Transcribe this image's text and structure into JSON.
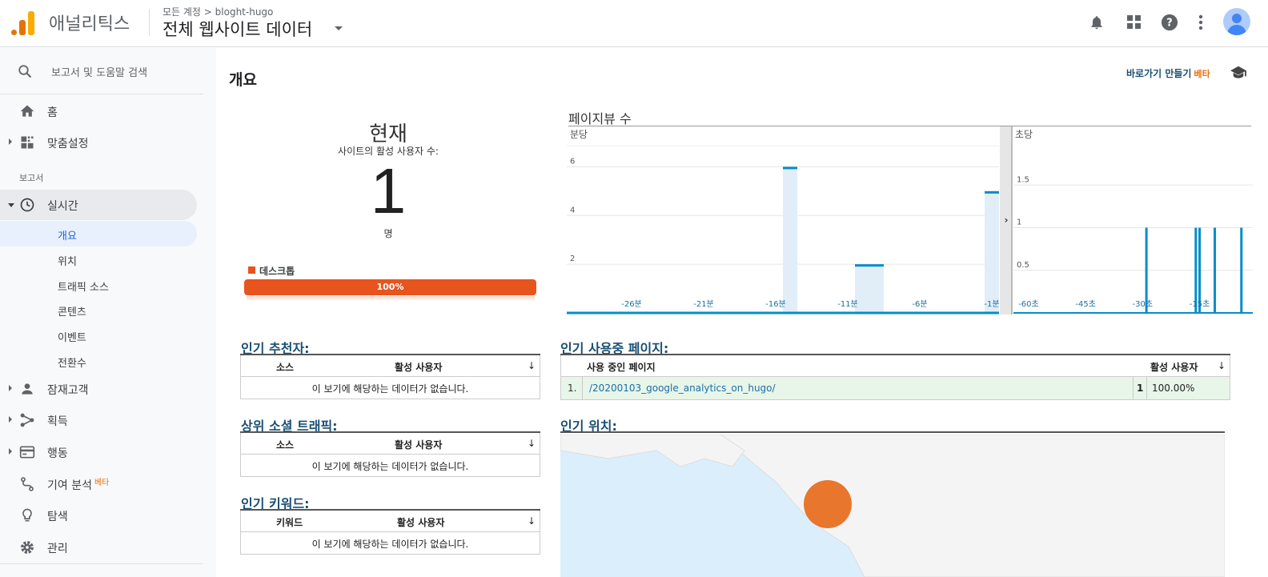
{
  "header": {
    "app_name": "애널리틱스",
    "breadcrumb": "모든 계정 > bloght-hugo",
    "view_name": "전체 웹사이트 데이터"
  },
  "sidebar": {
    "search_placeholder": "보고서 및 도움말 검색",
    "home": "홈",
    "customize": "맞춤설정",
    "reports_label": "보고서",
    "realtime": "실시간",
    "realtime_items": [
      "개요",
      "위치",
      "트래픽 소스",
      "콘텐츠",
      "이벤트",
      "전환수"
    ],
    "audience": "잠재고객",
    "acquisition": "획득",
    "behavior": "행동",
    "attribution": "기여 분석",
    "attribution_badge": "베타",
    "discover": "탐색",
    "admin": "관리"
  },
  "main": {
    "title": "개요",
    "shortcut_label": "바로가기 만들기",
    "shortcut_badge": "베타",
    "now": {
      "heading": "현재",
      "subtitle": "사이트의 활성 사용자 수:",
      "count": "1",
      "unit": "명",
      "device_label": "데스크톱",
      "device_percent": "100%",
      "device_fraction": 1.0
    },
    "top_referrals": {
      "title": "인기 추천자:",
      "col1": "소스",
      "col2": "활성 사용자",
      "empty": "이 보기에 해당하는 데이터가 없습니다."
    },
    "top_social": {
      "title": "상위 소셜 트래픽:",
      "col1": "소스",
      "col2": "활성 사용자",
      "empty": "이 보기에 해당하는 데이터가 없습니다."
    },
    "top_keywords": {
      "title": "인기 키워드:",
      "col1": "키워드",
      "col2": "활성 사용자",
      "empty": "이 보기에 해당하는 데이터가 없습니다."
    },
    "top_pages": {
      "title": "인기 사용중 페이지:",
      "col1": "사용 중인 페이지",
      "col2": "활성 사용자",
      "rows": [
        {
          "rank": "1.",
          "page": "/20200103_google_analytics_on_hugo/",
          "users": "1",
          "percent": "100.00%"
        }
      ]
    },
    "top_locations": {
      "title": "인기 위치:"
    }
  },
  "chart_data": [
    {
      "type": "bar",
      "title": "페이지뷰 수",
      "subtitle": "분당",
      "x_tick_labels": [
        "-26분",
        "-21분",
        "-16분",
        "-11분",
        "-6분",
        "-1분"
      ],
      "y_tick_labels": [
        "2",
        "4",
        "6"
      ],
      "ylim": [
        0,
        7
      ],
      "x": [
        -30,
        -29,
        -28,
        -27,
        -26,
        -25,
        -24,
        -23,
        -22,
        -21,
        -20,
        -19,
        -18,
        -17,
        -16,
        -15,
        -14,
        -13,
        -12,
        -11,
        -10,
        -9,
        -8,
        -7,
        -6,
        -5,
        -4,
        -3,
        -2,
        -1
      ],
      "values": [
        0,
        0,
        0,
        0,
        0,
        0,
        0,
        0,
        0,
        0,
        0,
        0,
        0,
        0,
        0,
        6,
        0,
        0,
        0,
        0,
        2,
        2,
        0,
        0,
        0,
        0,
        0,
        0,
        0,
        5
      ],
      "color": "#058dc7"
    },
    {
      "type": "bar",
      "subtitle": "초당",
      "x_tick_labels": [
        "-60초",
        "-45초",
        "-30초",
        "-15초"
      ],
      "y_tick_labels": [
        "0.5",
        "1",
        "1.5"
      ],
      "ylim": [
        0,
        2
      ],
      "x": [
        -29,
        -16,
        -15,
        -11,
        -4
      ],
      "values": [
        1,
        1,
        1,
        1,
        1
      ],
      "color": "#058dc7"
    }
  ]
}
